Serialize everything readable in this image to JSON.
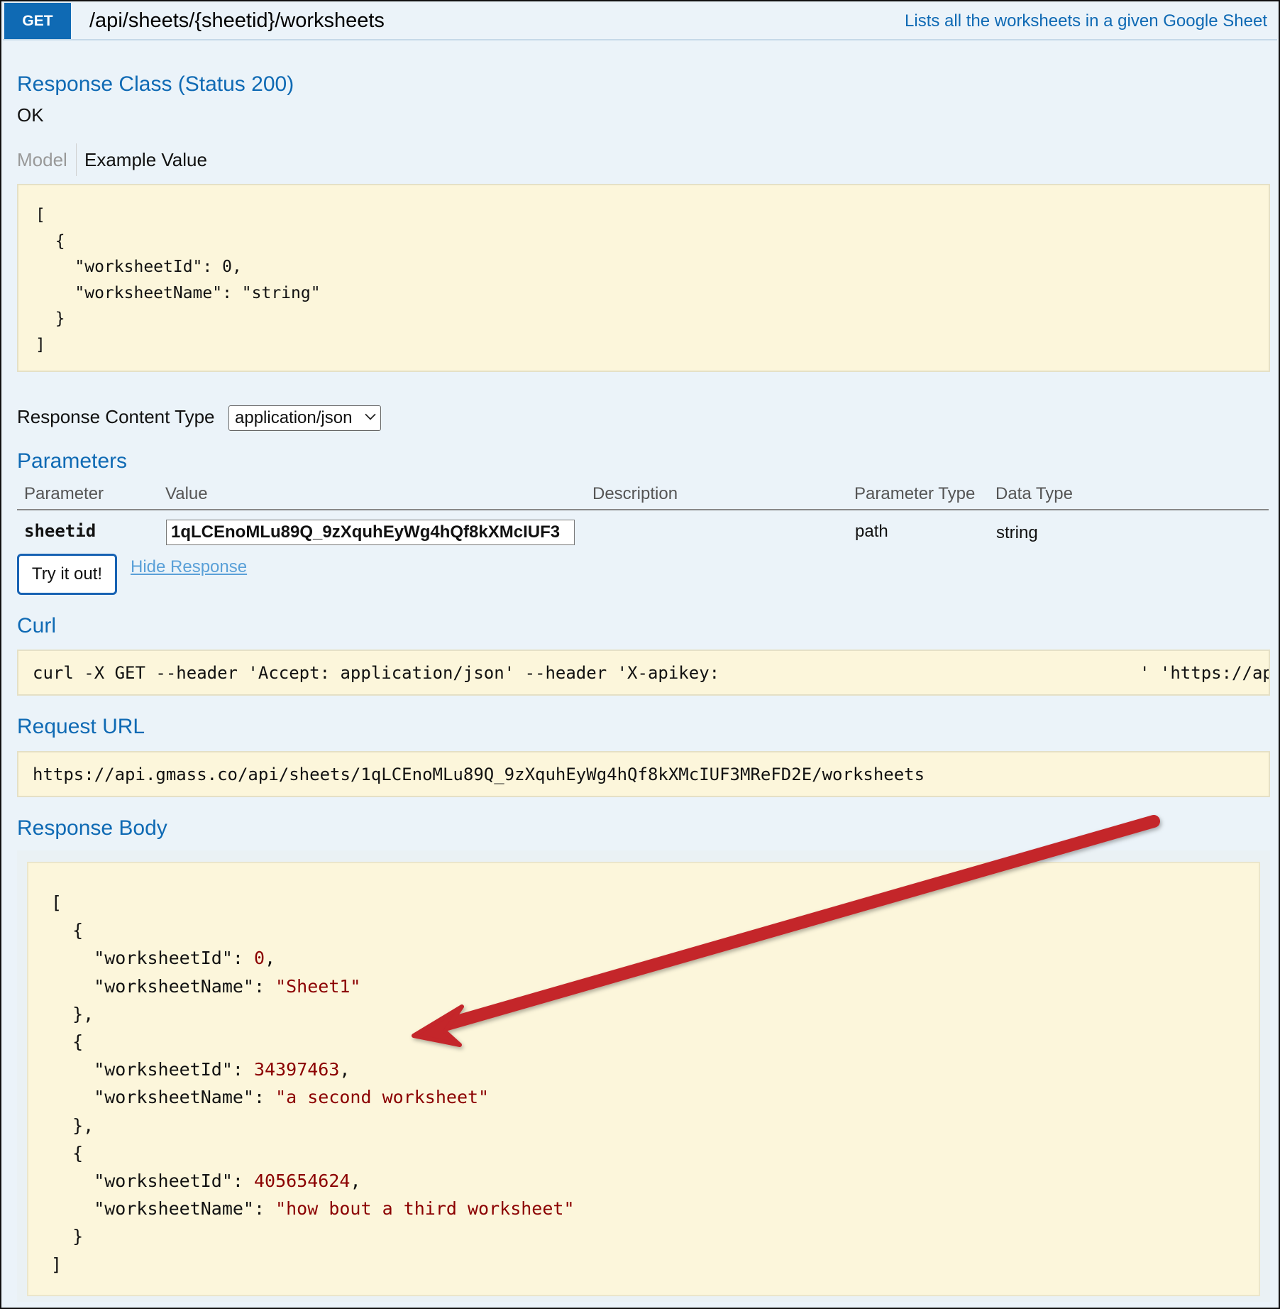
{
  "header": {
    "method": "GET",
    "path": "/api/sheets/{sheetid}/worksheets",
    "summary": "Lists all the worksheets in a given Google Sheet"
  },
  "response_class": {
    "title": "Response Class (Status 200)",
    "status_text": "OK",
    "tab_model": "Model",
    "tab_example": "Example Value",
    "example": {
      "l1": "[",
      "l2": "  {",
      "l3": "    \"worksheetId\": 0,",
      "l4": "    \"worksheetName\": \"string\"",
      "l5": "  }",
      "l6": "]"
    }
  },
  "content_type": {
    "label": "Response Content Type",
    "selected": "application/json"
  },
  "parameters": {
    "title": "Parameters",
    "headers": [
      "Parameter",
      "Value",
      "Description",
      "Parameter Type",
      "Data Type"
    ],
    "row": {
      "name": "sheetid",
      "value": "1qLCEnoMLu89Q_9zXquhEyWg4hQf8kXMcIUF3",
      "param_type": "path",
      "data_type": "string"
    }
  },
  "actions": {
    "try_label": "Try it out!",
    "hide_label": "Hide Response"
  },
  "curl": {
    "title": "Curl",
    "command_start": "curl -X GET --header 'Accept: application/json' --header 'X-apikey:",
    "command_end": "' 'https://api."
  },
  "request_url": {
    "title": "Request URL",
    "url": "https://api.gmass.co/api/sheets/1qLCEnoMLu89Q_9zXquhEyWg4hQf8kXMcIUF3MReFD2E/worksheets"
  },
  "response_body": {
    "title": "Response Body",
    "items": [
      {
        "id": "0",
        "name": "\"Sheet1\""
      },
      {
        "id": "34397463",
        "name": "\"a second worksheet\""
      },
      {
        "id": "405654624",
        "name": "\"how bout a third worksheet\""
      }
    ]
  },
  "colors": {
    "accent": "#0f6ab4",
    "value_red": "#8b0000",
    "annotation_arrow": "#c4252c",
    "code_bg": "#fcf6db"
  }
}
